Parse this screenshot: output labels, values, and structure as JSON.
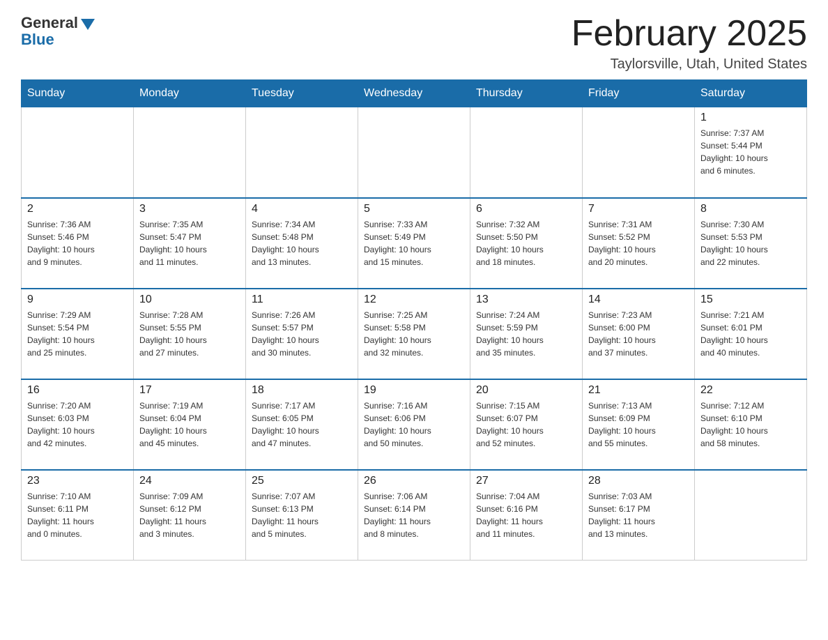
{
  "logo": {
    "general": "General",
    "blue": "Blue"
  },
  "title": "February 2025",
  "location": "Taylorsville, Utah, United States",
  "days_of_week": [
    "Sunday",
    "Monday",
    "Tuesday",
    "Wednesday",
    "Thursday",
    "Friday",
    "Saturday"
  ],
  "weeks": [
    [
      {
        "day": "",
        "info": ""
      },
      {
        "day": "",
        "info": ""
      },
      {
        "day": "",
        "info": ""
      },
      {
        "day": "",
        "info": ""
      },
      {
        "day": "",
        "info": ""
      },
      {
        "day": "",
        "info": ""
      },
      {
        "day": "1",
        "info": "Sunrise: 7:37 AM\nSunset: 5:44 PM\nDaylight: 10 hours\nand 6 minutes."
      }
    ],
    [
      {
        "day": "2",
        "info": "Sunrise: 7:36 AM\nSunset: 5:46 PM\nDaylight: 10 hours\nand 9 minutes."
      },
      {
        "day": "3",
        "info": "Sunrise: 7:35 AM\nSunset: 5:47 PM\nDaylight: 10 hours\nand 11 minutes."
      },
      {
        "day": "4",
        "info": "Sunrise: 7:34 AM\nSunset: 5:48 PM\nDaylight: 10 hours\nand 13 minutes."
      },
      {
        "day": "5",
        "info": "Sunrise: 7:33 AM\nSunset: 5:49 PM\nDaylight: 10 hours\nand 15 minutes."
      },
      {
        "day": "6",
        "info": "Sunrise: 7:32 AM\nSunset: 5:50 PM\nDaylight: 10 hours\nand 18 minutes."
      },
      {
        "day": "7",
        "info": "Sunrise: 7:31 AM\nSunset: 5:52 PM\nDaylight: 10 hours\nand 20 minutes."
      },
      {
        "day": "8",
        "info": "Sunrise: 7:30 AM\nSunset: 5:53 PM\nDaylight: 10 hours\nand 22 minutes."
      }
    ],
    [
      {
        "day": "9",
        "info": "Sunrise: 7:29 AM\nSunset: 5:54 PM\nDaylight: 10 hours\nand 25 minutes."
      },
      {
        "day": "10",
        "info": "Sunrise: 7:28 AM\nSunset: 5:55 PM\nDaylight: 10 hours\nand 27 minutes."
      },
      {
        "day": "11",
        "info": "Sunrise: 7:26 AM\nSunset: 5:57 PM\nDaylight: 10 hours\nand 30 minutes."
      },
      {
        "day": "12",
        "info": "Sunrise: 7:25 AM\nSunset: 5:58 PM\nDaylight: 10 hours\nand 32 minutes."
      },
      {
        "day": "13",
        "info": "Sunrise: 7:24 AM\nSunset: 5:59 PM\nDaylight: 10 hours\nand 35 minutes."
      },
      {
        "day": "14",
        "info": "Sunrise: 7:23 AM\nSunset: 6:00 PM\nDaylight: 10 hours\nand 37 minutes."
      },
      {
        "day": "15",
        "info": "Sunrise: 7:21 AM\nSunset: 6:01 PM\nDaylight: 10 hours\nand 40 minutes."
      }
    ],
    [
      {
        "day": "16",
        "info": "Sunrise: 7:20 AM\nSunset: 6:03 PM\nDaylight: 10 hours\nand 42 minutes."
      },
      {
        "day": "17",
        "info": "Sunrise: 7:19 AM\nSunset: 6:04 PM\nDaylight: 10 hours\nand 45 minutes."
      },
      {
        "day": "18",
        "info": "Sunrise: 7:17 AM\nSunset: 6:05 PM\nDaylight: 10 hours\nand 47 minutes."
      },
      {
        "day": "19",
        "info": "Sunrise: 7:16 AM\nSunset: 6:06 PM\nDaylight: 10 hours\nand 50 minutes."
      },
      {
        "day": "20",
        "info": "Sunrise: 7:15 AM\nSunset: 6:07 PM\nDaylight: 10 hours\nand 52 minutes."
      },
      {
        "day": "21",
        "info": "Sunrise: 7:13 AM\nSunset: 6:09 PM\nDaylight: 10 hours\nand 55 minutes."
      },
      {
        "day": "22",
        "info": "Sunrise: 7:12 AM\nSunset: 6:10 PM\nDaylight: 10 hours\nand 58 minutes."
      }
    ],
    [
      {
        "day": "23",
        "info": "Sunrise: 7:10 AM\nSunset: 6:11 PM\nDaylight: 11 hours\nand 0 minutes."
      },
      {
        "day": "24",
        "info": "Sunrise: 7:09 AM\nSunset: 6:12 PM\nDaylight: 11 hours\nand 3 minutes."
      },
      {
        "day": "25",
        "info": "Sunrise: 7:07 AM\nSunset: 6:13 PM\nDaylight: 11 hours\nand 5 minutes."
      },
      {
        "day": "26",
        "info": "Sunrise: 7:06 AM\nSunset: 6:14 PM\nDaylight: 11 hours\nand 8 minutes."
      },
      {
        "day": "27",
        "info": "Sunrise: 7:04 AM\nSunset: 6:16 PM\nDaylight: 11 hours\nand 11 minutes."
      },
      {
        "day": "28",
        "info": "Sunrise: 7:03 AM\nSunset: 6:17 PM\nDaylight: 11 hours\nand 13 minutes."
      },
      {
        "day": "",
        "info": ""
      }
    ]
  ]
}
